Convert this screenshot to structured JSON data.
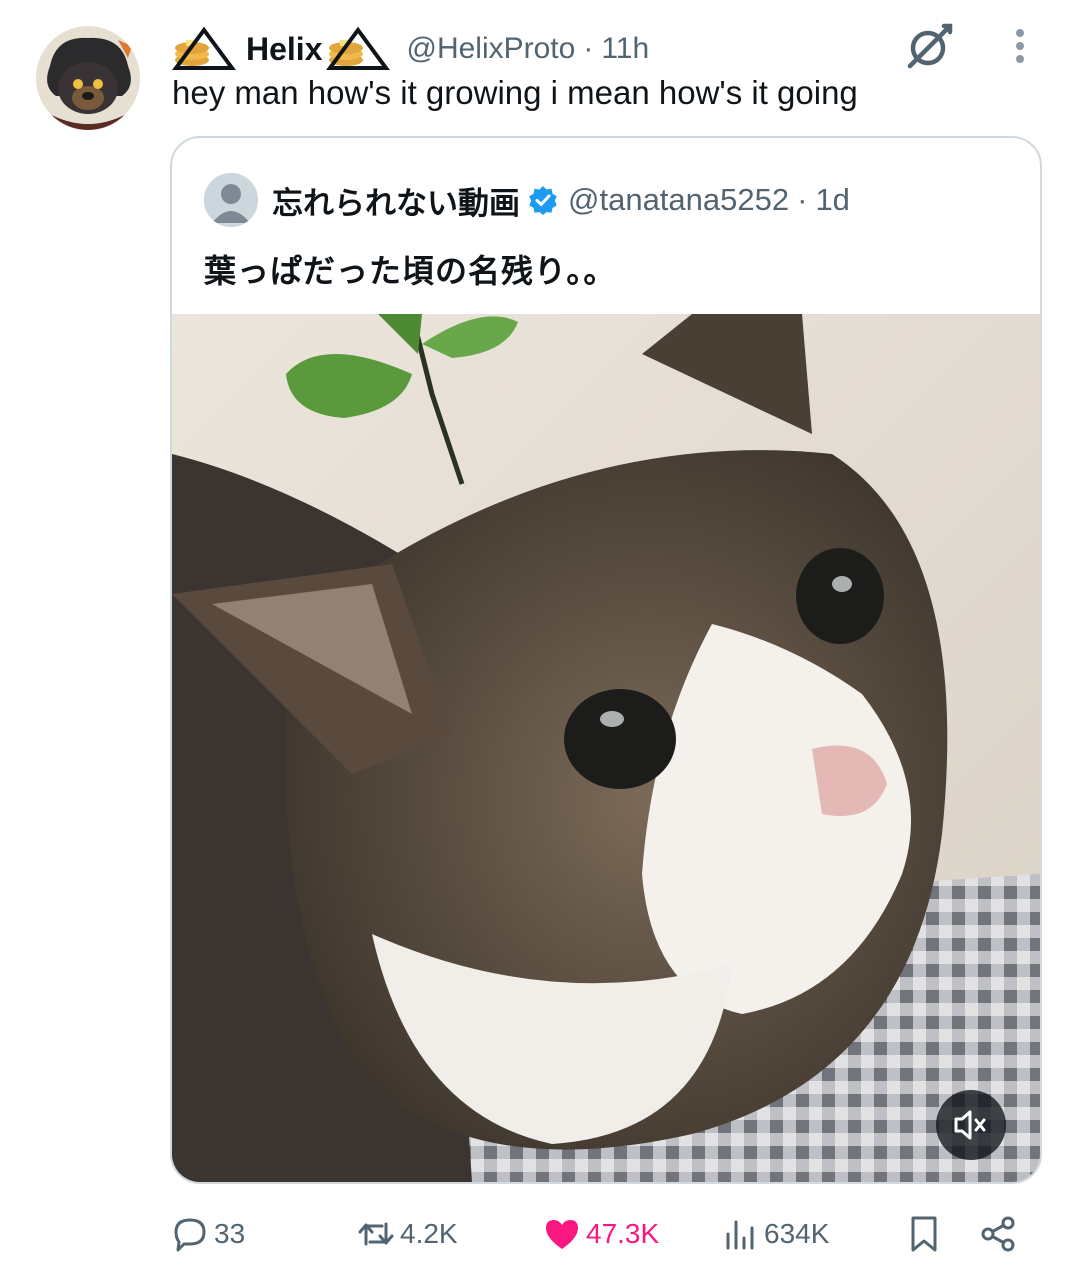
{
  "post": {
    "author_name": "Helix",
    "author_handle": "@HelixProto",
    "separator": "·",
    "time": "11h",
    "text": "hey man how's it growing i mean how's it going"
  },
  "quoted": {
    "author_name": "忘れられない動画",
    "author_handle": "@tanatana5252",
    "separator": "·",
    "time": "1d",
    "text": "葉っぱだった頃の名残り。。"
  },
  "actions": {
    "replies": "33",
    "reposts": "4.2K",
    "likes": "47.3K",
    "views": "634K"
  },
  "icons": {
    "header": [
      "pancake-triangle-icon",
      "grok-icon",
      "more-icon"
    ],
    "quoted": [
      "default-avatar-icon",
      "verified-badge-icon"
    ],
    "media": [
      "mute-icon"
    ],
    "actions": [
      "reply-icon",
      "repost-icon",
      "like-icon",
      "views-icon",
      "bookmark-icon",
      "share-icon"
    ]
  },
  "colors": {
    "text": "#0f1419",
    "secondary": "#536471",
    "border": "#cfd9de",
    "like": "#f91880",
    "verified": "#1d9bf0"
  }
}
